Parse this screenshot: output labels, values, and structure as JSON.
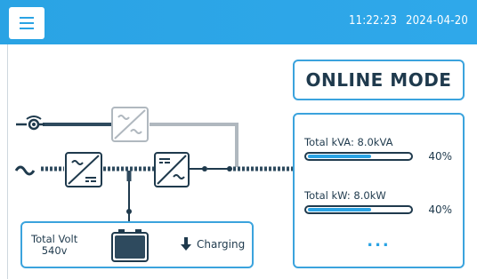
{
  "header": {
    "time": "11:22:23",
    "date": "2024-04-20"
  },
  "mode": {
    "label": "ONLINE MODE"
  },
  "stats": [
    {
      "label": "Total kVA: 8.0kVA",
      "percent_text": "40%",
      "percent": 40
    },
    {
      "label": "Total kW: 8.0kW",
      "percent_text": "40%",
      "percent": 40
    }
  ],
  "more": {
    "label": "..."
  },
  "battery": {
    "label_line1": "Total Volt",
    "label_line2": "540v",
    "status": "Charging"
  },
  "icons": {
    "menu": "hamburger-menu-icon",
    "bypass": "bypass-input-icon",
    "ac": "ac-sine-icon",
    "rectifier": "rectifier-icon",
    "inverter": "inverter-icon",
    "static_switch": "bypass-switch-icon",
    "battery": "battery-icon",
    "arrow": "arrow-down-icon"
  },
  "colors": {
    "header": "#2aa3e4",
    "accent": "#3ba3dd",
    "dark": "#1f3a4d",
    "bypass_line": "#b0b8bf"
  }
}
